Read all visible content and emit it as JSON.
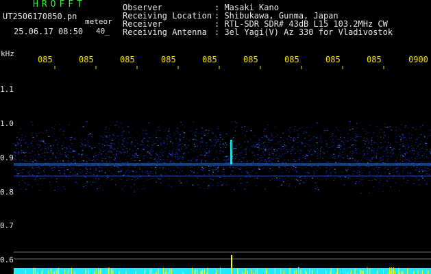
{
  "header": {
    "brand": "HROFFT",
    "filename": "UT2506170850.pn",
    "tag": "meteor",
    "datetime": "25.06.17 08:50",
    "tick_40": "40_",
    "fields": [
      {
        "label": "Observer",
        "value": ": Masaki Kano"
      },
      {
        "label": "Receiving Location",
        "value": ": Shibukawa, Gunma, Japan"
      },
      {
        "label": "Receiver",
        "value": ": RTL-SDR SDR# 43dB L15 103.2MHz CW"
      },
      {
        "label": "Receiving Antenna",
        "value": ": 3el Yagi(V) Az 330 for Vladivostok"
      }
    ]
  },
  "axis": {
    "unit": "kHz",
    "time_labels": [
      "085",
      "085",
      "085",
      "085",
      "085",
      "085",
      "085",
      "085",
      "085",
      "0900"
    ],
    "freq_labels": [
      "1.1",
      "1.0",
      "0.9",
      "0.8",
      "0.7",
      "0.6"
    ]
  },
  "colors": {
    "background": "#000000",
    "text_white": "#e8e8e8",
    "text_yellow": "#f0e000",
    "text_green": "#33ee33",
    "echo_bright": "#30ffff",
    "noise_blue": "#1b2fd0",
    "level_cyan": "#20e8ff",
    "level_yellow": "#ffff00"
  }
}
